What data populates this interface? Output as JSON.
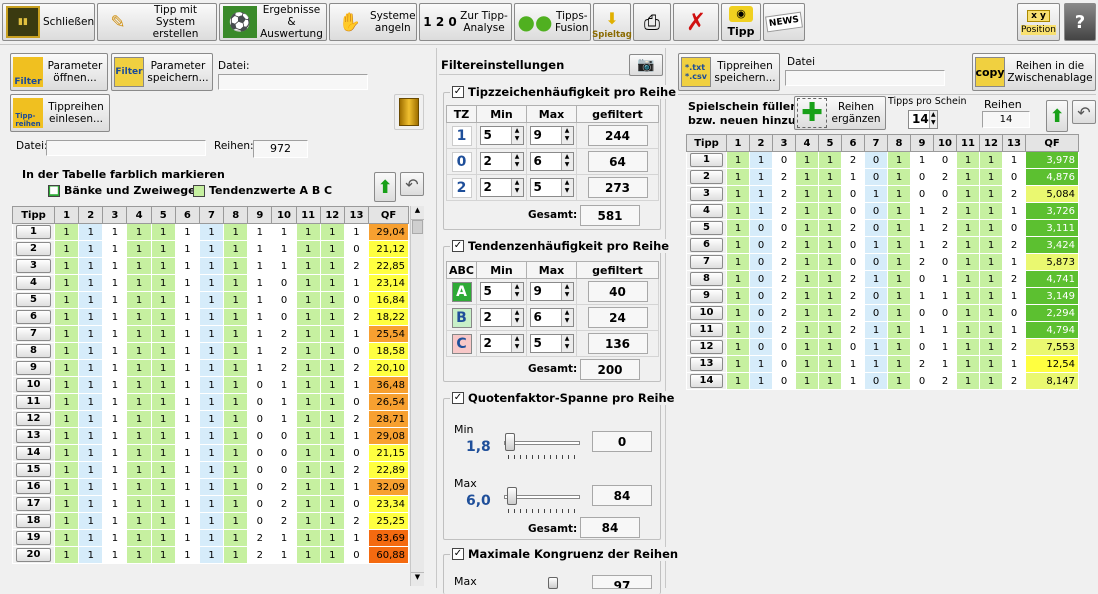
{
  "toolbar": {
    "close": "Schließen",
    "create": "Tipp mit System\nerstellen",
    "results": "Ergebnisse &\nAuswertung",
    "systems": "Systeme\nangeln",
    "analysis": "Zur Tipp-\nAnalyse",
    "fusion": "Tipps-\nFusion",
    "spieltag": "Spieltag",
    "tipp": "Tipp",
    "news": "NEWS",
    "position": "Position",
    "xy": "x y"
  },
  "left": {
    "param_open": "Parameter\nöffnen...",
    "param_save": "Parameter\nspeichern...",
    "datei_label": "Datei:",
    "tippreihen_load": "Tippreihen\neinlesen...",
    "datei2_label": "Datei:",
    "reihen_label": "Reihen:",
    "reihen_value": "972",
    "mark_title": "In der Tabelle farblich markieren",
    "mark_banks": "Bänke und Zweiwege",
    "mark_tend": "Tendenzwerte A B C",
    "filter_icon": "Filter",
    "tipp_icon": "Tipp-\nreihen"
  },
  "table_headers": [
    "Tipp",
    "1",
    "2",
    "3",
    "4",
    "5",
    "6",
    "7",
    "8",
    "9",
    "10",
    "11",
    "12",
    "13",
    "QF"
  ],
  "left_rows": [
    {
      "n": "1",
      "v": [
        "1",
        "1",
        "1",
        "1",
        "1",
        "1",
        "1",
        "1",
        "1",
        "1",
        "1",
        "1",
        "1"
      ],
      "qf": "29,04",
      "c": "#f7a030"
    },
    {
      "n": "2",
      "v": [
        "1",
        "1",
        "1",
        "1",
        "1",
        "1",
        "1",
        "1",
        "1",
        "1",
        "1",
        "1",
        "0"
      ],
      "qf": "21,12",
      "c": "#ffff40"
    },
    {
      "n": "3",
      "v": [
        "1",
        "1",
        "1",
        "1",
        "1",
        "1",
        "1",
        "1",
        "1",
        "1",
        "1",
        "1",
        "2"
      ],
      "qf": "22,85",
      "c": "#ffff40"
    },
    {
      "n": "4",
      "v": [
        "1",
        "1",
        "1",
        "1",
        "1",
        "1",
        "1",
        "1",
        "1",
        "0",
        "1",
        "1",
        "1"
      ],
      "qf": "23,14",
      "c": "#ffff40"
    },
    {
      "n": "5",
      "v": [
        "1",
        "1",
        "1",
        "1",
        "1",
        "1",
        "1",
        "1",
        "1",
        "0",
        "1",
        "1",
        "0"
      ],
      "qf": "16,84",
      "c": "#ffff40"
    },
    {
      "n": "6",
      "v": [
        "1",
        "1",
        "1",
        "1",
        "1",
        "1",
        "1",
        "1",
        "1",
        "0",
        "1",
        "1",
        "2"
      ],
      "qf": "18,22",
      "c": "#ffff40"
    },
    {
      "n": "7",
      "v": [
        "1",
        "1",
        "1",
        "1",
        "1",
        "1",
        "1",
        "1",
        "1",
        "2",
        "1",
        "1",
        "1"
      ],
      "qf": "25,54",
      "c": "#f7a030"
    },
    {
      "n": "8",
      "v": [
        "1",
        "1",
        "1",
        "1",
        "1",
        "1",
        "1",
        "1",
        "1",
        "2",
        "1",
        "1",
        "0"
      ],
      "qf": "18,58",
      "c": "#ffff40"
    },
    {
      "n": "9",
      "v": [
        "1",
        "1",
        "1",
        "1",
        "1",
        "1",
        "1",
        "1",
        "1",
        "2",
        "1",
        "1",
        "2"
      ],
      "qf": "20,10",
      "c": "#ffff40"
    },
    {
      "n": "10",
      "v": [
        "1",
        "1",
        "1",
        "1",
        "1",
        "1",
        "1",
        "1",
        "0",
        "1",
        "1",
        "1",
        "1"
      ],
      "qf": "36,48",
      "c": "#f7a030"
    },
    {
      "n": "11",
      "v": [
        "1",
        "1",
        "1",
        "1",
        "1",
        "1",
        "1",
        "1",
        "0",
        "1",
        "1",
        "1",
        "0"
      ],
      "qf": "26,54",
      "c": "#f7a030"
    },
    {
      "n": "12",
      "v": [
        "1",
        "1",
        "1",
        "1",
        "1",
        "1",
        "1",
        "1",
        "0",
        "1",
        "1",
        "1",
        "2"
      ],
      "qf": "28,71",
      "c": "#f7a030"
    },
    {
      "n": "13",
      "v": [
        "1",
        "1",
        "1",
        "1",
        "1",
        "1",
        "1",
        "1",
        "0",
        "0",
        "1",
        "1",
        "1"
      ],
      "qf": "29,08",
      "c": "#f7a030"
    },
    {
      "n": "14",
      "v": [
        "1",
        "1",
        "1",
        "1",
        "1",
        "1",
        "1",
        "1",
        "0",
        "0",
        "1",
        "1",
        "0"
      ],
      "qf": "21,15",
      "c": "#ffff40"
    },
    {
      "n": "15",
      "v": [
        "1",
        "1",
        "1",
        "1",
        "1",
        "1",
        "1",
        "1",
        "0",
        "0",
        "1",
        "1",
        "2"
      ],
      "qf": "22,89",
      "c": "#ffff40"
    },
    {
      "n": "16",
      "v": [
        "1",
        "1",
        "1",
        "1",
        "1",
        "1",
        "1",
        "1",
        "0",
        "2",
        "1",
        "1",
        "1"
      ],
      "qf": "32,09",
      "c": "#f7a030"
    },
    {
      "n": "17",
      "v": [
        "1",
        "1",
        "1",
        "1",
        "1",
        "1",
        "1",
        "1",
        "0",
        "2",
        "1",
        "1",
        "0"
      ],
      "qf": "23,34",
      "c": "#ffff40"
    },
    {
      "n": "18",
      "v": [
        "1",
        "1",
        "1",
        "1",
        "1",
        "1",
        "1",
        "1",
        "0",
        "2",
        "1",
        "1",
        "2"
      ],
      "qf": "25,25",
      "c": "#ffff40"
    },
    {
      "n": "19",
      "v": [
        "1",
        "1",
        "1",
        "1",
        "1",
        "1",
        "1",
        "1",
        "2",
        "1",
        "1",
        "1",
        "1"
      ],
      "qf": "83,69",
      "c": "#f46a10"
    },
    {
      "n": "20",
      "v": [
        "1",
        "1",
        "1",
        "1",
        "1",
        "1",
        "1",
        "1",
        "2",
        "1",
        "1",
        "1",
        "0"
      ],
      "qf": "60,88",
      "c": "#f46a10"
    }
  ],
  "filter": {
    "title": "Filtereinstellungen",
    "tz_title": "Tipzzeichenhäufigkeit pro Reihe",
    "col_tz": "TZ",
    "col_min": "Min",
    "col_max": "Max",
    "col_filt": "gefiltert",
    "tz_rows": [
      {
        "k": "1",
        "min": "5",
        "max": "9",
        "f": "244"
      },
      {
        "k": "0",
        "min": "2",
        "max": "6",
        "f": "64"
      },
      {
        "k": "2",
        "min": "2",
        "max": "5",
        "f": "273"
      }
    ],
    "gesamt_label": "Gesamt:",
    "tz_total": "581",
    "tend_title": "Tendenzenhäufigkeit pro Reihe",
    "col_abc": "ABC",
    "tend_rows": [
      {
        "k": "A",
        "min": "5",
        "max": "9",
        "f": "40",
        "c": "#2eaa36",
        "fc": "#ffffff"
      },
      {
        "k": "B",
        "min": "2",
        "max": "6",
        "f": "24",
        "c": "#c8f0c8",
        "fc": "#1f4f9a"
      },
      {
        "k": "C",
        "min": "2",
        "max": "5",
        "f": "136",
        "c": "#f8c8c8",
        "fc": "#1f4f9a"
      }
    ],
    "tend_total": "200",
    "qf_title": "Quotenfaktor-Spanne pro Reihe",
    "min_label": "Min",
    "min_value": "1,8",
    "min_count": "0",
    "max_label": "Max",
    "max_value": "6,0",
    "max_count": "84",
    "qf_total": "84",
    "kong_title": "Maximale Kongruenz der Reihen",
    "kong_max": "Max",
    "kong_count": "97"
  },
  "right": {
    "csv_btn": "Tippreihen\nspeichern...",
    "csv_icon": "*.txt\n*.csv",
    "datei_label": "Datei",
    "copy_btn": "Reihen in die\nZwischenablage",
    "copy_icon": "copy",
    "spielschein": "Spielschein füllen\nbzw. neuen hinzu",
    "ergaenzen": "Reihen\nergänzen",
    "tipps_pro_schein": "Tipps pro Schein",
    "tipps_value": "14",
    "reihen_label": "Reihen",
    "reihen_value": "14"
  },
  "right_rows": [
    {
      "n": "1",
      "v": [
        "1",
        "1",
        "0",
        "1",
        "1",
        "2",
        "0",
        "1",
        "1",
        "0",
        "1",
        "1",
        "1"
      ],
      "qf": "3,978"
    },
    {
      "n": "2",
      "v": [
        "1",
        "1",
        "2",
        "1",
        "1",
        "1",
        "0",
        "1",
        "0",
        "2",
        "1",
        "1",
        "0"
      ],
      "qf": "4,876"
    },
    {
      "n": "3",
      "v": [
        "1",
        "1",
        "2",
        "1",
        "1",
        "0",
        "1",
        "1",
        "0",
        "0",
        "1",
        "1",
        "2"
      ],
      "qf": "5,084",
      "c": "#eaf870"
    },
    {
      "n": "4",
      "v": [
        "1",
        "1",
        "2",
        "1",
        "1",
        "0",
        "0",
        "1",
        "1",
        "2",
        "1",
        "1",
        "1"
      ],
      "qf": "3,726"
    },
    {
      "n": "5",
      "v": [
        "1",
        "0",
        "0",
        "1",
        "1",
        "2",
        "0",
        "1",
        "1",
        "2",
        "1",
        "1",
        "0"
      ],
      "qf": "3,111"
    },
    {
      "n": "6",
      "v": [
        "1",
        "0",
        "2",
        "1",
        "1",
        "0",
        "1",
        "1",
        "1",
        "2",
        "1",
        "1",
        "2"
      ],
      "qf": "3,424"
    },
    {
      "n": "7",
      "v": [
        "1",
        "0",
        "2",
        "1",
        "1",
        "0",
        "0",
        "1",
        "2",
        "0",
        "1",
        "1",
        "1"
      ],
      "qf": "5,873",
      "c": "#eaf870"
    },
    {
      "n": "8",
      "v": [
        "1",
        "0",
        "2",
        "1",
        "1",
        "2",
        "1",
        "1",
        "0",
        "1",
        "1",
        "1",
        "2"
      ],
      "qf": "4,741"
    },
    {
      "n": "9",
      "v": [
        "1",
        "0",
        "2",
        "1",
        "1",
        "2",
        "0",
        "1",
        "1",
        "1",
        "1",
        "1",
        "1"
      ],
      "qf": "3,149"
    },
    {
      "n": "10",
      "v": [
        "1",
        "0",
        "2",
        "1",
        "1",
        "2",
        "0",
        "1",
        "0",
        "0",
        "1",
        "1",
        "0"
      ],
      "qf": "2,294"
    },
    {
      "n": "11",
      "v": [
        "1",
        "0",
        "2",
        "1",
        "1",
        "2",
        "1",
        "1",
        "1",
        "1",
        "1",
        "1",
        "1"
      ],
      "qf": "4,794"
    },
    {
      "n": "12",
      "v": [
        "1",
        "0",
        "0",
        "1",
        "1",
        "0",
        "1",
        "1",
        "0",
        "1",
        "1",
        "1",
        "2"
      ],
      "qf": "7,553",
      "c": "#eaf870"
    },
    {
      "n": "13",
      "v": [
        "1",
        "1",
        "0",
        "1",
        "1",
        "1",
        "1",
        "1",
        "2",
        "1",
        "1",
        "1",
        "1"
      ],
      "qf": "12,54",
      "c": "#ffff40"
    },
    {
      "n": "14",
      "v": [
        "1",
        "1",
        "0",
        "1",
        "1",
        "1",
        "0",
        "1",
        "0",
        "2",
        "1",
        "1",
        "2"
      ],
      "qf": "8,147",
      "c": "#eaf870"
    }
  ],
  "colors": {
    "green": "#c6f0a0",
    "blue": "#d6ecfa",
    "qf_green": "#5cc030",
    "hdr": "#e4e4e4"
  }
}
